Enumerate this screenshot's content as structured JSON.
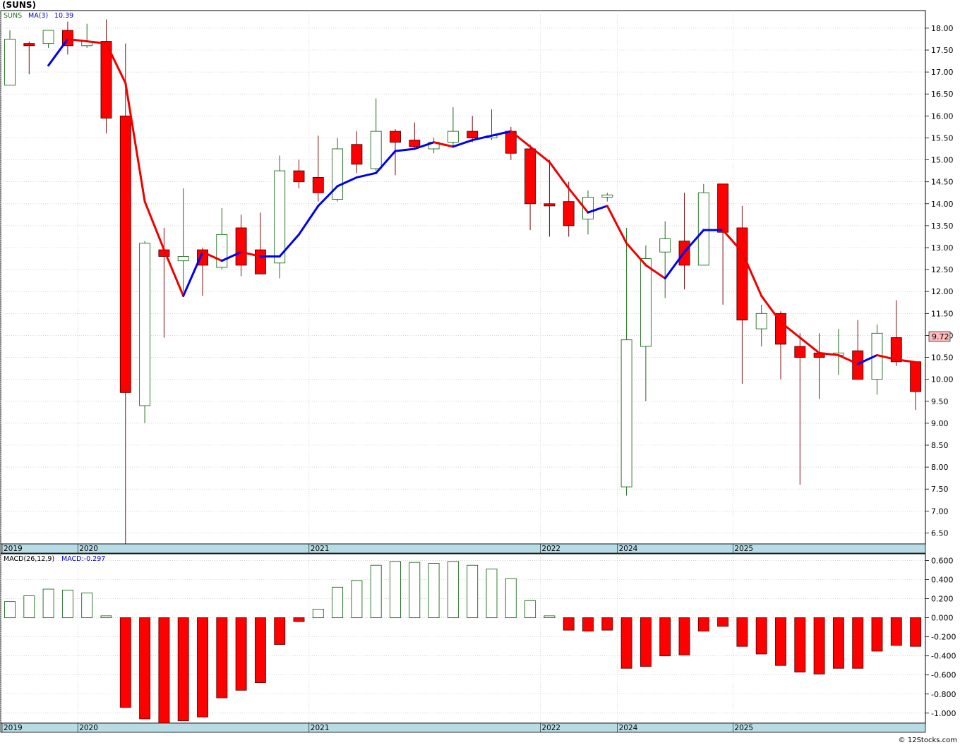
{
  "symbol_title": "(SUNS)",
  "footer": "© 12Stocks.com",
  "colors": {
    "up": "#1e6b1e",
    "down": "#ff0000",
    "ma_up": "#0000ee",
    "ma_down": "#ee0000",
    "axis_band": "#b8dce6",
    "grid": "#bbbbbb",
    "last_price_box": "#ffbbbb"
  },
  "chart_data": [
    {
      "type": "candlestick",
      "legend": {
        "symbol": "SUNS",
        "ma_label": "MA(3)",
        "ma_value": "10.39"
      },
      "last_price_label": "9.72",
      "ylim": [
        6.25,
        18.4
      ],
      "yticks": [
        "18.00",
        "17.50",
        "17.00",
        "16.50",
        "16.00",
        "15.50",
        "15.00",
        "14.50",
        "14.00",
        "13.50",
        "13.00",
        "12.50",
        "12.00",
        "11.50",
        "11.00",
        "10.50",
        "10.00",
        "9.50",
        "9.00",
        "8.50",
        "8.00",
        "7.50",
        "7.00",
        "6.50"
      ],
      "candles": [
        {
          "o": 16.7,
          "h": 17.95,
          "l": 16.7,
          "c": 17.75
        },
        {
          "o": 17.65,
          "h": 17.7,
          "l": 16.95,
          "c": 17.6
        },
        {
          "o": 17.65,
          "h": 17.95,
          "l": 17.55,
          "c": 17.95
        },
        {
          "o": 17.95,
          "h": 18.15,
          "l": 17.4,
          "c": 17.6
        },
        {
          "o": 17.6,
          "h": 18.1,
          "l": 17.55,
          "c": 17.7
        },
        {
          "o": 17.7,
          "h": 18.2,
          "l": 15.6,
          "c": 15.95
        },
        {
          "o": 16.0,
          "h": 17.65,
          "l": 6.25,
          "c": 9.7
        },
        {
          "o": 9.4,
          "h": 13.15,
          "l": 9.0,
          "c": 13.1
        },
        {
          "o": 12.95,
          "h": 13.45,
          "l": 10.95,
          "c": 12.8
        },
        {
          "o": 12.7,
          "h": 14.35,
          "l": 12.0,
          "c": 12.8
        },
        {
          "o": 12.95,
          "h": 13.0,
          "l": 11.9,
          "c": 12.6
        },
        {
          "o": 12.55,
          "h": 13.9,
          "l": 12.5,
          "c": 13.3
        },
        {
          "o": 13.45,
          "h": 13.75,
          "l": 12.35,
          "c": 12.6
        },
        {
          "o": 12.95,
          "h": 13.8,
          "l": 12.4,
          "c": 12.4
        },
        {
          "o": 12.65,
          "h": 15.1,
          "l": 12.3,
          "c": 14.75
        },
        {
          "o": 14.75,
          "h": 15.0,
          "l": 14.35,
          "c": 14.5
        },
        {
          "o": 14.6,
          "h": 15.55,
          "l": 14.05,
          "c": 14.25
        },
        {
          "o": 14.1,
          "h": 15.5,
          "l": 14.05,
          "c": 15.25
        },
        {
          "o": 15.35,
          "h": 15.65,
          "l": 14.7,
          "c": 14.9
        },
        {
          "o": 14.8,
          "h": 16.4,
          "l": 14.75,
          "c": 15.65
        },
        {
          "o": 15.65,
          "h": 15.7,
          "l": 14.65,
          "c": 15.4
        },
        {
          "o": 15.45,
          "h": 15.85,
          "l": 15.25,
          "c": 15.3
        },
        {
          "o": 15.25,
          "h": 15.5,
          "l": 15.15,
          "c": 15.4
        },
        {
          "o": 15.4,
          "h": 16.2,
          "l": 15.3,
          "c": 15.65
        },
        {
          "o": 15.65,
          "h": 16.0,
          "l": 15.4,
          "c": 15.5
        },
        {
          "o": 15.5,
          "h": 16.15,
          "l": 15.45,
          "c": 15.55
        },
        {
          "o": 15.65,
          "h": 15.75,
          "l": 15.0,
          "c": 15.15
        },
        {
          "o": 15.25,
          "h": 15.35,
          "l": 13.4,
          "c": 14.0
        },
        {
          "o": 14.0,
          "h": 15.0,
          "l": 13.25,
          "c": 13.95
        },
        {
          "o": 14.05,
          "h": 14.5,
          "l": 13.25,
          "c": 13.5
        },
        {
          "o": 13.65,
          "h": 14.3,
          "l": 13.3,
          "c": 14.15
        },
        {
          "o": 14.15,
          "h": 14.25,
          "l": 14.05,
          "c": 14.2
        },
        {
          "o": 7.55,
          "h": 13.45,
          "l": 7.35,
          "c": 10.9
        },
        {
          "o": 10.75,
          "h": 13.05,
          "l": 9.5,
          "c": 12.75
        },
        {
          "o": 12.9,
          "h": 13.6,
          "l": 11.85,
          "c": 13.2
        },
        {
          "o": 13.15,
          "h": 14.25,
          "l": 12.05,
          "c": 12.6
        },
        {
          "o": 12.6,
          "h": 14.45,
          "l": 12.6,
          "c": 14.25
        },
        {
          "o": 14.45,
          "h": 14.45,
          "l": 11.7,
          "c": 13.35
        },
        {
          "o": 13.45,
          "h": 13.95,
          "l": 9.9,
          "c": 11.35
        },
        {
          "o": 11.15,
          "h": 11.7,
          "l": 10.75,
          "c": 11.5
        },
        {
          "o": 11.5,
          "h": 11.55,
          "l": 10.0,
          "c": 10.8
        },
        {
          "o": 10.75,
          "h": 11.05,
          "l": 7.6,
          "c": 10.5
        },
        {
          "o": 10.6,
          "h": 11.05,
          "l": 9.55,
          "c": 10.5
        },
        {
          "o": 10.55,
          "h": 11.15,
          "l": 10.1,
          "c": 10.6
        },
        {
          "o": 10.65,
          "h": 11.35,
          "l": 10.0,
          "c": 10.0
        },
        {
          "o": 10.0,
          "h": 11.25,
          "l": 9.65,
          "c": 11.05
        },
        {
          "o": 10.95,
          "h": 11.8,
          "l": 10.3,
          "c": 10.4
        },
        {
          "o": 10.4,
          "h": 10.4,
          "l": 9.3,
          "c": 9.72
        }
      ],
      "ma": [
        null,
        null,
        17.15,
        17.75,
        17.7,
        17.65,
        16.75,
        14.05,
        12.95,
        11.9,
        12.9,
        12.7,
        12.9,
        12.8,
        12.8,
        13.3,
        13.95,
        14.4,
        14.6,
        14.7,
        15.2,
        15.25,
        15.4,
        15.3,
        15.45,
        15.55,
        15.65,
        15.3,
        14.95,
        14.35,
        13.8,
        13.95,
        13.1,
        12.6,
        12.3,
        12.9,
        13.4,
        13.4,
        12.9,
        11.9,
        11.3,
        10.95,
        10.6,
        10.55,
        10.35,
        10.55,
        10.45,
        10.39
      ],
      "xlabels": [
        {
          "i": 0,
          "label": "2019"
        },
        {
          "i": 4,
          "label": "2020"
        },
        {
          "i": 16,
          "label": "2021"
        },
        {
          "i": 28,
          "label": "2022"
        },
        {
          "i": 32,
          "label": "2024"
        },
        {
          "i": 38,
          "label": "2025"
        }
      ]
    },
    {
      "type": "bar",
      "legend": {
        "label": "MACD(26,12,9)",
        "value_label": "MACD:-0.297"
      },
      "ylim": [
        -1.105,
        0.67
      ],
      "yticks": [
        "0.600",
        "0.400",
        "0.200",
        "0.000",
        "-0.200",
        "-0.400",
        "-0.600",
        "-0.800",
        "-1.000"
      ],
      "values": [
        0.17,
        0.23,
        0.3,
        0.29,
        0.26,
        0.02,
        -0.94,
        -1.06,
        -1.11,
        -1.08,
        -1.04,
        -0.84,
        -0.76,
        -0.68,
        -0.28,
        -0.04,
        0.09,
        0.32,
        0.39,
        0.55,
        0.59,
        0.58,
        0.57,
        0.59,
        0.55,
        0.51,
        0.41,
        0.18,
        0.02,
        -0.13,
        -0.14,
        -0.13,
        -0.53,
        -0.51,
        -0.4,
        -0.39,
        -0.14,
        -0.09,
        -0.3,
        -0.38,
        -0.5,
        -0.57,
        -0.59,
        -0.53,
        -0.53,
        -0.35,
        -0.29,
        -0.3
      ]
    }
  ]
}
